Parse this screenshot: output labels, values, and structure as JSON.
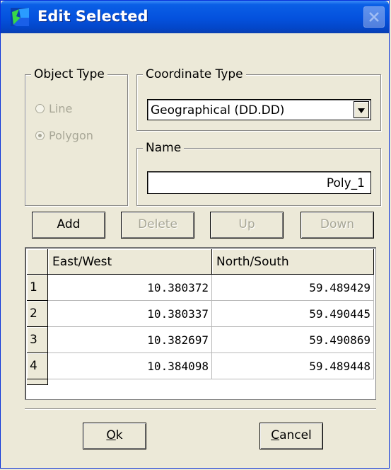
{
  "window": {
    "title": "Edit Selected"
  },
  "object_type": {
    "legend": "Object Type",
    "options": [
      {
        "label": "Line",
        "checked": false,
        "enabled": false
      },
      {
        "label": "Polygon",
        "checked": true,
        "enabled": false
      }
    ]
  },
  "coordinate_type": {
    "legend": "Coordinate Type",
    "selected": "Geographical (DD.DD)"
  },
  "name": {
    "legend": "Name",
    "value": "Poly_1"
  },
  "toolbar": {
    "add_label": "Add",
    "delete_label": "Delete",
    "up_label": "Up",
    "down_label": "Down"
  },
  "table": {
    "columns": [
      "East/West",
      "North/South"
    ],
    "rows": [
      {
        "index": "1",
        "east_west": "10.380372",
        "north_south": "59.489429"
      },
      {
        "index": "2",
        "east_west": "10.380337",
        "north_south": "59.490445"
      },
      {
        "index": "3",
        "east_west": "10.382697",
        "north_south": "59.490869"
      },
      {
        "index": "4",
        "east_west": "10.384098",
        "north_south": "59.489448"
      }
    ]
  },
  "footer": {
    "ok_mnemonic": "O",
    "ok_rest": "k",
    "cancel_mnemonic": "C",
    "cancel_rest": "ancel"
  },
  "colors": {
    "titlebar": "#0451dd",
    "face": "#ece9d8",
    "disabled_text": "#a8a797"
  }
}
